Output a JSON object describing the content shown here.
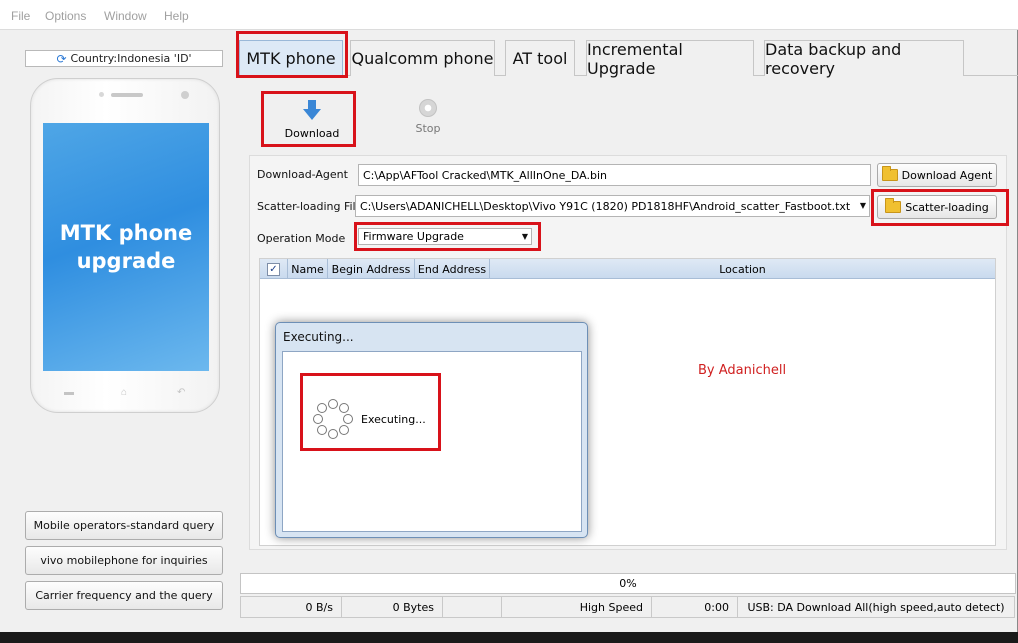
{
  "menu": [
    "File",
    "Options",
    "Window",
    "Help"
  ],
  "left_panel": {
    "country": "Country:Indonesia 'ID'",
    "phone_screen_text": "MTK phone\nupgrade",
    "buttons": [
      "Mobile operators-standard query",
      "vivo mobilephone for inquiries",
      "Carrier frequency and the query"
    ]
  },
  "tabs": [
    "MTK phone",
    "Qualcomm phone",
    "AT tool",
    "Incremental Upgrade",
    "Data backup and recovery"
  ],
  "toolbar": {
    "download_label": "Download",
    "stop_label": "Stop"
  },
  "form": {
    "download_agent_label": "Download-Agent",
    "download_agent_value": "C:\\App\\AFTool Cracked\\MTK_AllInOne_DA.bin",
    "download_agent_button": "Download Agent",
    "scatter_label": "Scatter-loading File",
    "scatter_value": "C:\\Users\\ADANICHELL\\Desktop\\Vivo Y91C (1820) PD1818HF\\Android_scatter_Fastboot.txt",
    "scatter_button": "Scatter-loading",
    "operation_mode_label": "Operation Mode",
    "operation_mode_value": "Firmware Upgrade"
  },
  "table": {
    "headers": [
      "Name",
      "Begin Address",
      "End Address",
      "Location"
    ],
    "select_all_checked": true
  },
  "watermark": "By Adanichell",
  "dialog": {
    "title": "Executing...",
    "message": "Executing..."
  },
  "status": {
    "progress_text": "0%",
    "progress_value": 0,
    "speed": "0 B/s",
    "bytes": "0 Bytes",
    "mode": "High Speed",
    "time": "0:00",
    "usb": "USB: DA Download All(high speed,auto detect)"
  },
  "colors": {
    "highlight_box": "#d8121a",
    "watermark": "#d02020",
    "accent": "#2f8ee0"
  }
}
